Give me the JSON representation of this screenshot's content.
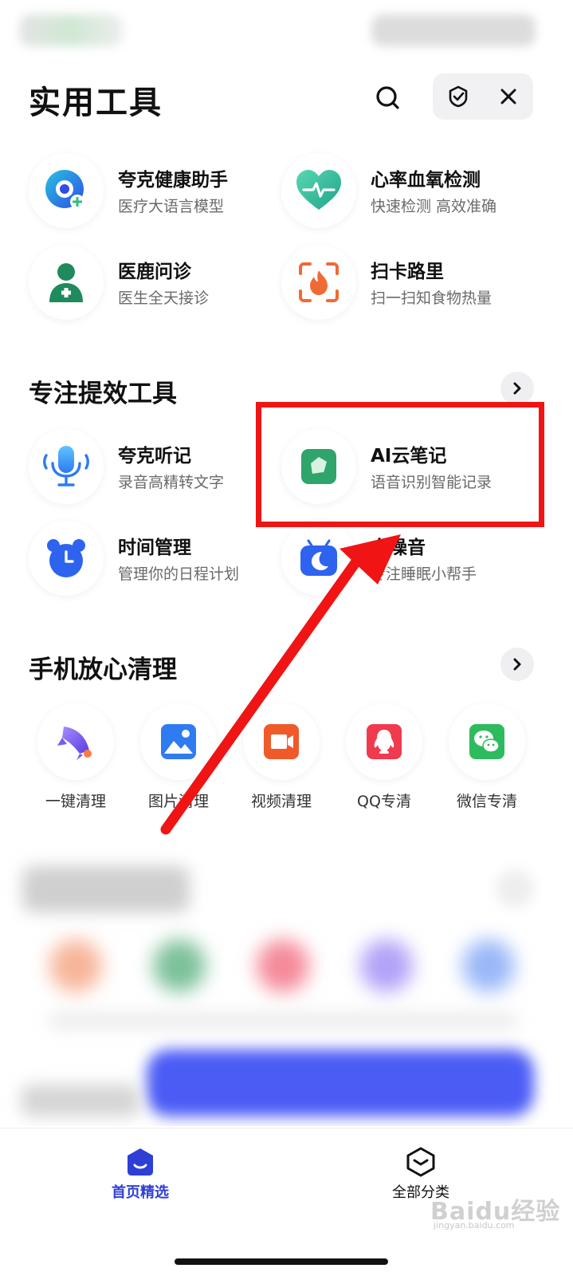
{
  "header": {
    "title": "实用工具",
    "search_icon": "search-icon",
    "capsule_icons": [
      "shield-check-icon",
      "close-icon"
    ]
  },
  "featured_tools": [
    {
      "name": "夸克健康助手",
      "desc": "医疗大语言模型",
      "icon": "health-assistant-icon"
    },
    {
      "name": "心率血氧检测",
      "desc": "快速检测 高效准确",
      "icon": "heart-rate-icon"
    },
    {
      "name": "医鹿问诊",
      "desc": "医生全天接诊",
      "icon": "doctor-icon"
    },
    {
      "name": "扫卡路里",
      "desc": "扫一扫知食物热量",
      "icon": "calorie-scan-icon"
    }
  ],
  "focus_section": {
    "title": "专注提效工具",
    "tools": [
      {
        "name": "夸克听记",
        "desc": "录音高精转文字",
        "icon": "microphone-icon"
      },
      {
        "name": "AI云笔记",
        "desc": "语音识别智能记录",
        "icon": "note-icon"
      },
      {
        "name": "时间管理",
        "desc": "管理你的日程计划",
        "icon": "alarm-clock-icon"
      },
      {
        "name": "白噪音",
        "desc": "专注睡眠小帮手",
        "icon": "white-noise-icon"
      }
    ]
  },
  "clean_section": {
    "title": "手机放心清理",
    "items": [
      {
        "label": "一键清理",
        "icon": "rocket-icon"
      },
      {
        "label": "图片清理",
        "icon": "image-icon"
      },
      {
        "label": "视频清理",
        "icon": "video-icon"
      },
      {
        "label": "QQ专清",
        "icon": "qq-icon"
      },
      {
        "label": "微信专清",
        "icon": "wechat-icon"
      }
    ]
  },
  "tab_bar": {
    "tabs": [
      {
        "label": "首页精选",
        "icon": "home-icon",
        "active": true
      },
      {
        "label": "全部分类",
        "icon": "category-icon",
        "active": false
      }
    ]
  },
  "watermark": {
    "text": "Baidu经验",
    "sub": "jingyan.baidu.com"
  },
  "colors": {
    "primary": "#2e3fd6",
    "highlight": "#f01414",
    "text": "#111111",
    "subtext": "#6a6a6a"
  }
}
